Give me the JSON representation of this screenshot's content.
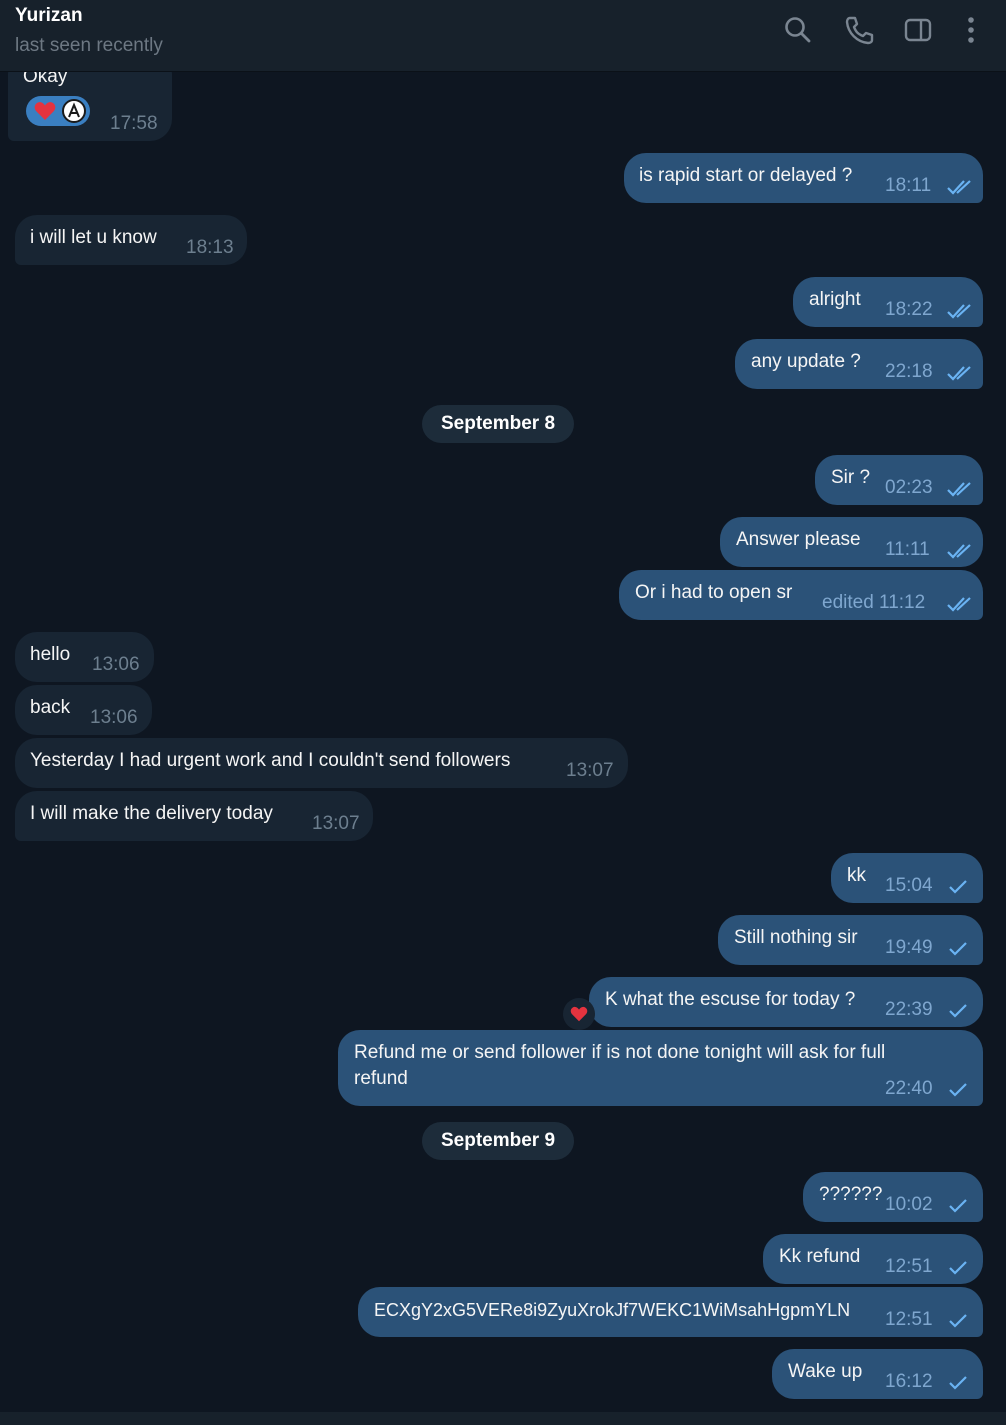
{
  "header": {
    "name": "Yurizan",
    "status": "last seen recently",
    "icons": [
      "search-icon",
      "phone-icon",
      "sidebar-toggle-icon",
      "more-vertical-icon"
    ]
  },
  "colors": {
    "background": "#0e1621",
    "header": "#17212b",
    "incoming_bubble": "#182533",
    "outgoing_bubble": "#2b5278",
    "timestamp_in": "#6d7f8f",
    "timestamp_out": "#7fa7cf",
    "tick": "#6ab3f3",
    "reaction": "#3a7fc1",
    "heart": "#e5333f"
  },
  "messages": {
    "m0": {
      "text": "Okay",
      "time": "17:58",
      "reactions": [
        "red-heart",
        "user-avatar"
      ]
    },
    "m1": {
      "text": "is rapid start or delayed ?",
      "time": "18:11",
      "status": "read"
    },
    "m2": {
      "text": "i will let u know",
      "time": "18:13"
    },
    "m3": {
      "text": "alright",
      "time": "18:22",
      "status": "read"
    },
    "m4": {
      "text": "any update ?",
      "time": "22:18",
      "status": "read"
    },
    "m5": {
      "text": "Sir ?",
      "time": "02:23",
      "status": "read"
    },
    "m6": {
      "text": "Answer please",
      "time": "11:11",
      "status": "read"
    },
    "m7": {
      "text": "Or i had to open sr",
      "time": "edited 11:12",
      "status": "read"
    },
    "m8": {
      "text": "hello",
      "time": "13:06"
    },
    "m9": {
      "text": "back",
      "time": "13:06"
    },
    "m10": {
      "text": "Yesterday I had urgent work and I couldn't send followers",
      "time": "13:07"
    },
    "m11": {
      "text": "I will make the delivery today",
      "time": "13:07"
    },
    "m12": {
      "text": "kk",
      "time": "15:04",
      "status": "sent"
    },
    "m13": {
      "text": "Still nothing sir",
      "time": "19:49",
      "status": "sent"
    },
    "m14": {
      "text": "K what the escuse for today ?",
      "time": "22:39",
      "status": "sent",
      "reaction": "red-heart"
    },
    "m15": {
      "line1": "Refund me or send follower if is not done tonight will ask for full",
      "line2": "refund",
      "time": "22:40",
      "status": "sent"
    },
    "m16": {
      "text": "??????",
      "time": "10:02",
      "status": "sent"
    },
    "m17": {
      "text": "Kk refund",
      "time": "12:51",
      "status": "sent"
    },
    "m18": {
      "text": "ECXgY2xG5VERe8i9ZyuXrokJf7WEKC1WiMsahHgpmYLN",
      "time": "12:51",
      "status": "sent"
    },
    "m19": {
      "text": "Wake up",
      "time": "16:12",
      "status": "sent"
    }
  },
  "dates": {
    "d1": "September 8",
    "d2": "September 9"
  }
}
